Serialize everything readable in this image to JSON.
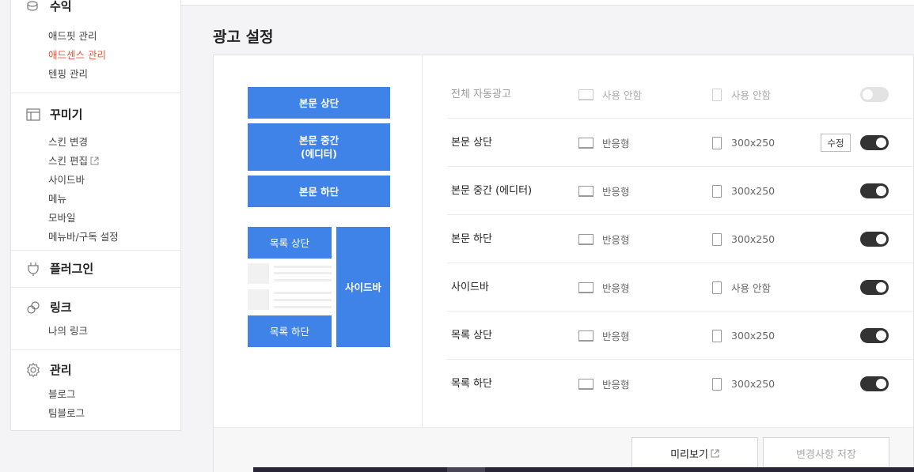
{
  "page_title": "광고 설정",
  "sidebar": {
    "groups": [
      {
        "title": "수익",
        "icon": "coin-icon",
        "items": [
          {
            "label": "애드핏 관리",
            "active": false
          },
          {
            "label": "애드센스 관리",
            "active": true
          },
          {
            "label": "텐핑 관리",
            "active": false
          }
        ]
      },
      {
        "title": "꾸미기",
        "icon": "layout-icon",
        "items": [
          {
            "label": "스킨 변경"
          },
          {
            "label": "스킨 편집",
            "external": true
          },
          {
            "label": "사이드바"
          },
          {
            "label": "메뉴"
          },
          {
            "label": "모바일"
          },
          {
            "label": "메뉴바/구독 설정"
          }
        ]
      },
      {
        "title": "플러그인",
        "icon": "plug-icon",
        "items": []
      },
      {
        "title": "링크",
        "icon": "link-icon",
        "items": [
          {
            "label": "나의 링크"
          }
        ]
      },
      {
        "title": "관리",
        "icon": "gear-icon",
        "items": [
          {
            "label": "블로그"
          },
          {
            "label": "팀블로그"
          }
        ]
      }
    ]
  },
  "preview": {
    "body_top": "본문 상단",
    "body_middle_line1": "본문 중간",
    "body_middle_line2": "(에디터)",
    "body_bottom": "본문 하단",
    "list_top": "목록 상단",
    "list_bottom": "목록 하단",
    "sidebar": "사이드바"
  },
  "settings": {
    "rows": [
      {
        "name": "전체 자동광고",
        "pc": "사용 안함",
        "mobile": "사용 안함",
        "enabled": false,
        "disabled": true
      },
      {
        "name": "본문 상단",
        "pc": "반응형",
        "mobile": "300x250",
        "enabled": true,
        "edit_label": "수정"
      },
      {
        "name": "본문 중간 (에디터)",
        "pc": "반응형",
        "mobile": "300x250",
        "enabled": true
      },
      {
        "name": "본문 하단",
        "pc": "반응형",
        "mobile": "300x250",
        "enabled": true
      },
      {
        "name": "사이드바",
        "pc": "반응형",
        "mobile": "사용 안함",
        "enabled": true
      },
      {
        "name": "목록 상단",
        "pc": "반응형",
        "mobile": "300x250",
        "enabled": true
      },
      {
        "name": "목록 하단",
        "pc": "반응형",
        "mobile": "300x250",
        "enabled": true
      }
    ]
  },
  "footer": {
    "preview_label": "미리보기",
    "save_label": "변경사항 저장"
  },
  "colors": {
    "accent_blue": "#3f83e8",
    "active_red": "#f35340",
    "toggle_on": "#333333"
  }
}
